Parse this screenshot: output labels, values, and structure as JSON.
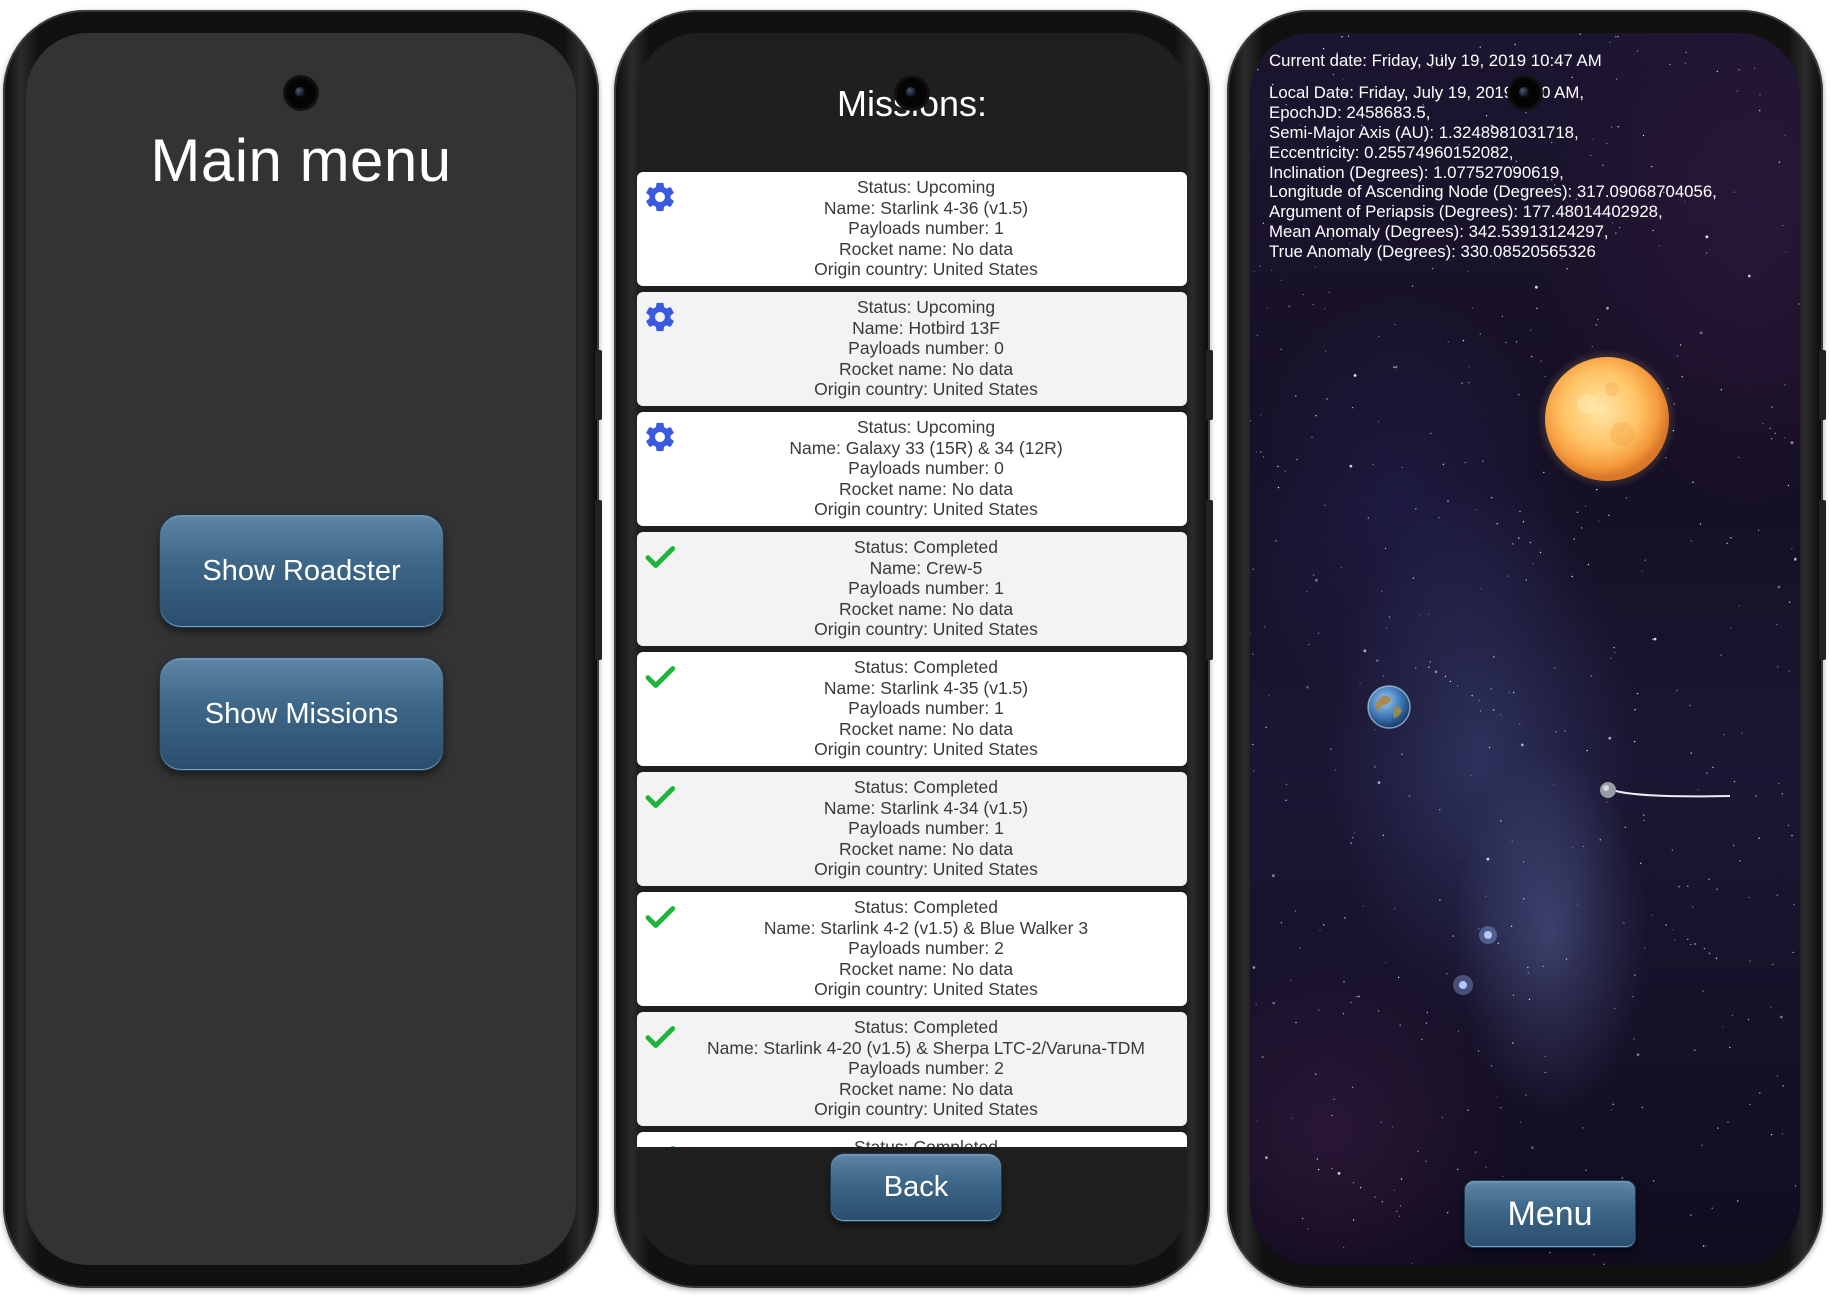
{
  "phone1": {
    "title": "Main menu",
    "buttons": {
      "show_roadster": "Show Roadster",
      "show_missions": "Show Missions"
    }
  },
  "phone2": {
    "title": "Missions:",
    "missions": [
      {
        "status": "Status: Upcoming",
        "name": "Name: Starlink 4-36 (v1.5)",
        "payloads": "Payloads number: 1",
        "rocket": "Rocket name: No data",
        "country": "Origin country: United States",
        "icon": "gear-icon"
      },
      {
        "status": "Status: Upcoming",
        "name": "Name: Hotbird 13F",
        "payloads": "Payloads number: 0",
        "rocket": "Rocket name: No data",
        "country": "Origin country: United States",
        "icon": "gear-icon"
      },
      {
        "status": "Status: Upcoming",
        "name": "Name: Galaxy 33 (15R) & 34 (12R)",
        "payloads": "Payloads number: 0",
        "rocket": "Rocket name: No data",
        "country": "Origin country: United States",
        "icon": "gear-icon"
      },
      {
        "status": "Status: Completed",
        "name": "Name: Crew-5",
        "payloads": "Payloads number: 1",
        "rocket": "Rocket name: No data",
        "country": "Origin country: United States",
        "icon": "checkmark-icon"
      },
      {
        "status": "Status: Completed",
        "name": "Name: Starlink 4-35 (v1.5)",
        "payloads": "Payloads number: 1",
        "rocket": "Rocket name: No data",
        "country": "Origin country: United States",
        "icon": "checkmark-icon"
      },
      {
        "status": "Status: Completed",
        "name": "Name: Starlink 4-34 (v1.5)",
        "payloads": "Payloads number: 1",
        "rocket": "Rocket name: No data",
        "country": "Origin country: United States",
        "icon": "checkmark-icon"
      },
      {
        "status": "Status: Completed",
        "name": "Name: Starlink 4-2 (v1.5) & Blue Walker 3",
        "payloads": "Payloads number: 2",
        "rocket": "Rocket name: No data",
        "country": "Origin country: United States",
        "icon": "checkmark-icon"
      },
      {
        "status": "Status: Completed",
        "name": "Name: Starlink 4-20 (v1.5) & Sherpa LTC-2/Varuna-TDM",
        "payloads": "Payloads number: 2",
        "rocket": "Rocket name: No data",
        "country": "Origin country: United States",
        "icon": "checkmark-icon"
      },
      {
        "status": "Status: Completed",
        "name": "",
        "payloads": "",
        "rocket": "",
        "country": "",
        "icon": "checkmark-icon"
      }
    ],
    "back_label": "Back"
  },
  "phone3": {
    "current_date": "Current date: Friday, July 19, 2019 10:47 AM",
    "orbit_lines": [
      "Local Date: Friday, July 19, 2019 2:00 AM,",
      "EpochJD: 2458683.5,",
      "Semi-Major Axis (AU): 1.3248981031718,",
      "Eccentricity: 0.25574960152082,",
      "Inclination (Degrees): 1.077527090619,",
      "Longitude of Ascending Node (Degrees): 317.09068704056,",
      "Argument of Periapsis (Degrees): 177.48014402928,",
      "Mean Anomaly (Degrees): 342.53913124297,",
      "True Anomaly (Degrees): 330.08520565326"
    ],
    "menu_label": "Menu"
  },
  "colors": {
    "button_top": "#5c85a6",
    "button_bottom": "#2a4d6d",
    "gear_icon": "#3a5be0",
    "check_icon": "#1eb53a",
    "menu_background": "#333333"
  }
}
